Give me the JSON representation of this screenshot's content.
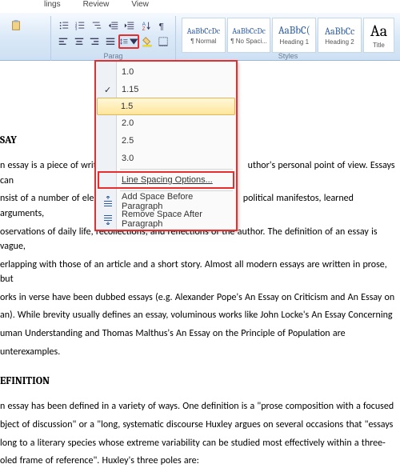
{
  "menubar": {
    "items": [
      "lings",
      "Review",
      "View"
    ]
  },
  "ribbon": {
    "paragraph_label": "Parag",
    "styles_label": "Styles",
    "styles": [
      {
        "preview": "AaBbCcDc",
        "name": "¶ Normal"
      },
      {
        "preview": "AaBbCcDc",
        "name": "¶ No Spaci..."
      },
      {
        "preview": "AaBbC(",
        "name": "Heading 1"
      },
      {
        "preview": "AaBbCc",
        "name": "Heading 2"
      },
      {
        "preview": "Aa",
        "name": "Title"
      }
    ]
  },
  "dropdown": {
    "items": [
      {
        "label": "1.0",
        "checked": false
      },
      {
        "label": "1.15",
        "checked": true
      },
      {
        "label": "1.5",
        "checked": false,
        "hover": true
      },
      {
        "label": "2.0",
        "checked": false
      },
      {
        "label": "2.5",
        "checked": false
      },
      {
        "label": "3.0",
        "checked": false
      }
    ],
    "options_label": "Line Spacing Options...",
    "add_before": "Add Space Before Paragraph",
    "remove_after": "Remove Space After Paragraph"
  },
  "doc": {
    "h1": "SAY",
    "p1": "n essay is a piece of writin",
    "p1b": "uthor's personal point of view. Essays can",
    "p2a": "nsist of a number of elen",
    "p2b": "political manifestos, learned arguments,",
    "p3": "oservations of daily life, recollections, and reflections of the author. The definition of an essay is vague,",
    "p4": "erlapping with those of an article  and a short story. Almost all modern essays are written in prose, but",
    "p5": "orks in verse have been dubbed essays (e.g. Alexander Pope's An Essay on Criticism and An Essay on",
    "p6": "an). While brevity usually defines an essay, voluminous works like John Locke's An Essay Concerning",
    "p7": "uman Understanding and Thomas Malthus's An Essay on the Principle of Population are",
    "p8": "unterexamples.",
    "h2": "EFINITION",
    "q1": "n essay has been defined in a variety of ways. One definition is a \"prose composition with a focused",
    "q2": "bject of discussion\" or a \"long, systematic discourse Huxley argues on several occasions that \"essays",
    "q3": "long to a literary species whose extreme variability can be studied most effectively within a three-",
    "q4": "oled frame of reference\". Huxley's three poles are:"
  }
}
